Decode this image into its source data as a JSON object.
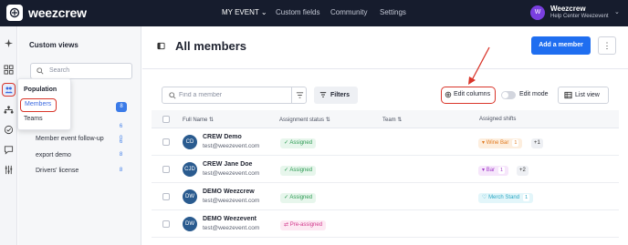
{
  "app": {
    "brand": "weezcrew"
  },
  "topnav": {
    "items": [
      "MY EVENT",
      "Custom fields",
      "Community",
      "Settings"
    ]
  },
  "account": {
    "initial": "W",
    "name": "Weezcrew",
    "subtitle": "Help Center Weezevent"
  },
  "sidebar": {
    "title": "Custom views",
    "search_placeholder": "Search",
    "views": [
      {
        "label": "Members",
        "count": "8"
      },
      {
        "label": "",
        "count": "6"
      },
      {
        "label": "",
        "count": "6"
      },
      {
        "label": "Member event follow-up",
        "count": "0"
      },
      {
        "label": "export demo",
        "count": "8"
      },
      {
        "label": "Drivers' license",
        "count": "8"
      }
    ]
  },
  "popup": {
    "title": "Population",
    "items": [
      "Members",
      "Teams"
    ]
  },
  "main": {
    "title": "All members",
    "add_button": "Add a member",
    "more_button": "⋮",
    "find_placeholder": "Find a member",
    "filters_label": "Filters",
    "edit_columns_label": "Edit columns",
    "edit_mode_label": "Edit mode",
    "edit_mode_on": false,
    "list_view_label": "List view"
  },
  "table": {
    "columns": [
      "Full Name",
      "Assignment status",
      "Team",
      "Assigned shifts"
    ],
    "rows": [
      {
        "initials": "CD",
        "name": "CREW Demo",
        "email": "test@weezevent.com",
        "status": "Assigned",
        "status_type": "assigned",
        "shift": "Wine Bar",
        "shift_count": "1",
        "shift_color": "orange",
        "more": "+1"
      },
      {
        "initials": "CJD",
        "name": "CREW Jane Doe",
        "email": "test@weezevent.com",
        "status": "Assigned",
        "status_type": "assigned",
        "shift": "Bar",
        "shift_count": "1",
        "shift_color": "purple",
        "more": "+2"
      },
      {
        "initials": "DW",
        "name": "DEMO Weezcrew",
        "email": "test@weezevent.com",
        "status": "Assigned",
        "status_type": "assigned",
        "shift": "Merch Stand",
        "shift_count": "1",
        "shift_color": "cyan",
        "more": ""
      },
      {
        "initials": "DW",
        "name": "DEMO Weezevent",
        "email": "test@weezevent.com",
        "status": "Pre-assigned",
        "status_type": "pre",
        "shift": "",
        "shift_count": "",
        "shift_color": "",
        "more": ""
      }
    ]
  },
  "colors": {
    "brand_blue": "#1f6ef0",
    "topbar": "#161c2d",
    "highlight_red": "#d9352a",
    "avatar_purple": "#7a3fe0",
    "assigned_green": "#2c9a52",
    "pre_pink": "#d0358a"
  },
  "icons": [
    "weezcrew-logo-icon",
    "chevron-down-icon",
    "search-icon",
    "filter-icon",
    "gear-icon",
    "list-icon",
    "sort-icon",
    "sidebar-toggle-icon",
    "check-icon",
    "sparkle-icon",
    "population-icon",
    "org-chart-icon",
    "check-circle-icon",
    "chat-icon",
    "settings-sliders-icon",
    "arrow-annotation-icon"
  ]
}
